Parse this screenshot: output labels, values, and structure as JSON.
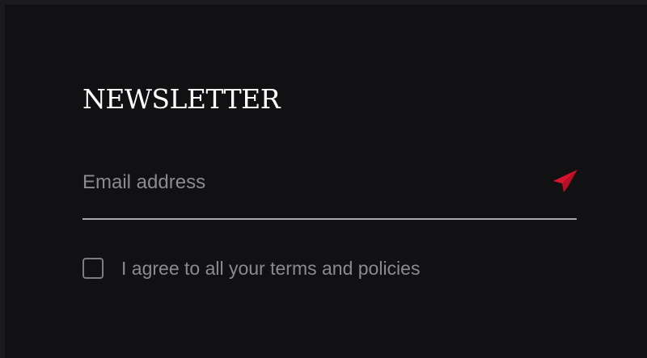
{
  "newsletter": {
    "title": "NEWSLETTER",
    "email_placeholder": "Email address",
    "email_value": "",
    "send_icon": "paper-plane-icon",
    "agree_label": "I agree to all your terms and policies",
    "agree_checked": false
  },
  "colors": {
    "background": "#111013",
    "outer_background": "#1b1a1f",
    "title": "#ffffff",
    "muted_text": "#8b8a90",
    "underline": "#a9a8ad",
    "accent": "#d9142d"
  }
}
